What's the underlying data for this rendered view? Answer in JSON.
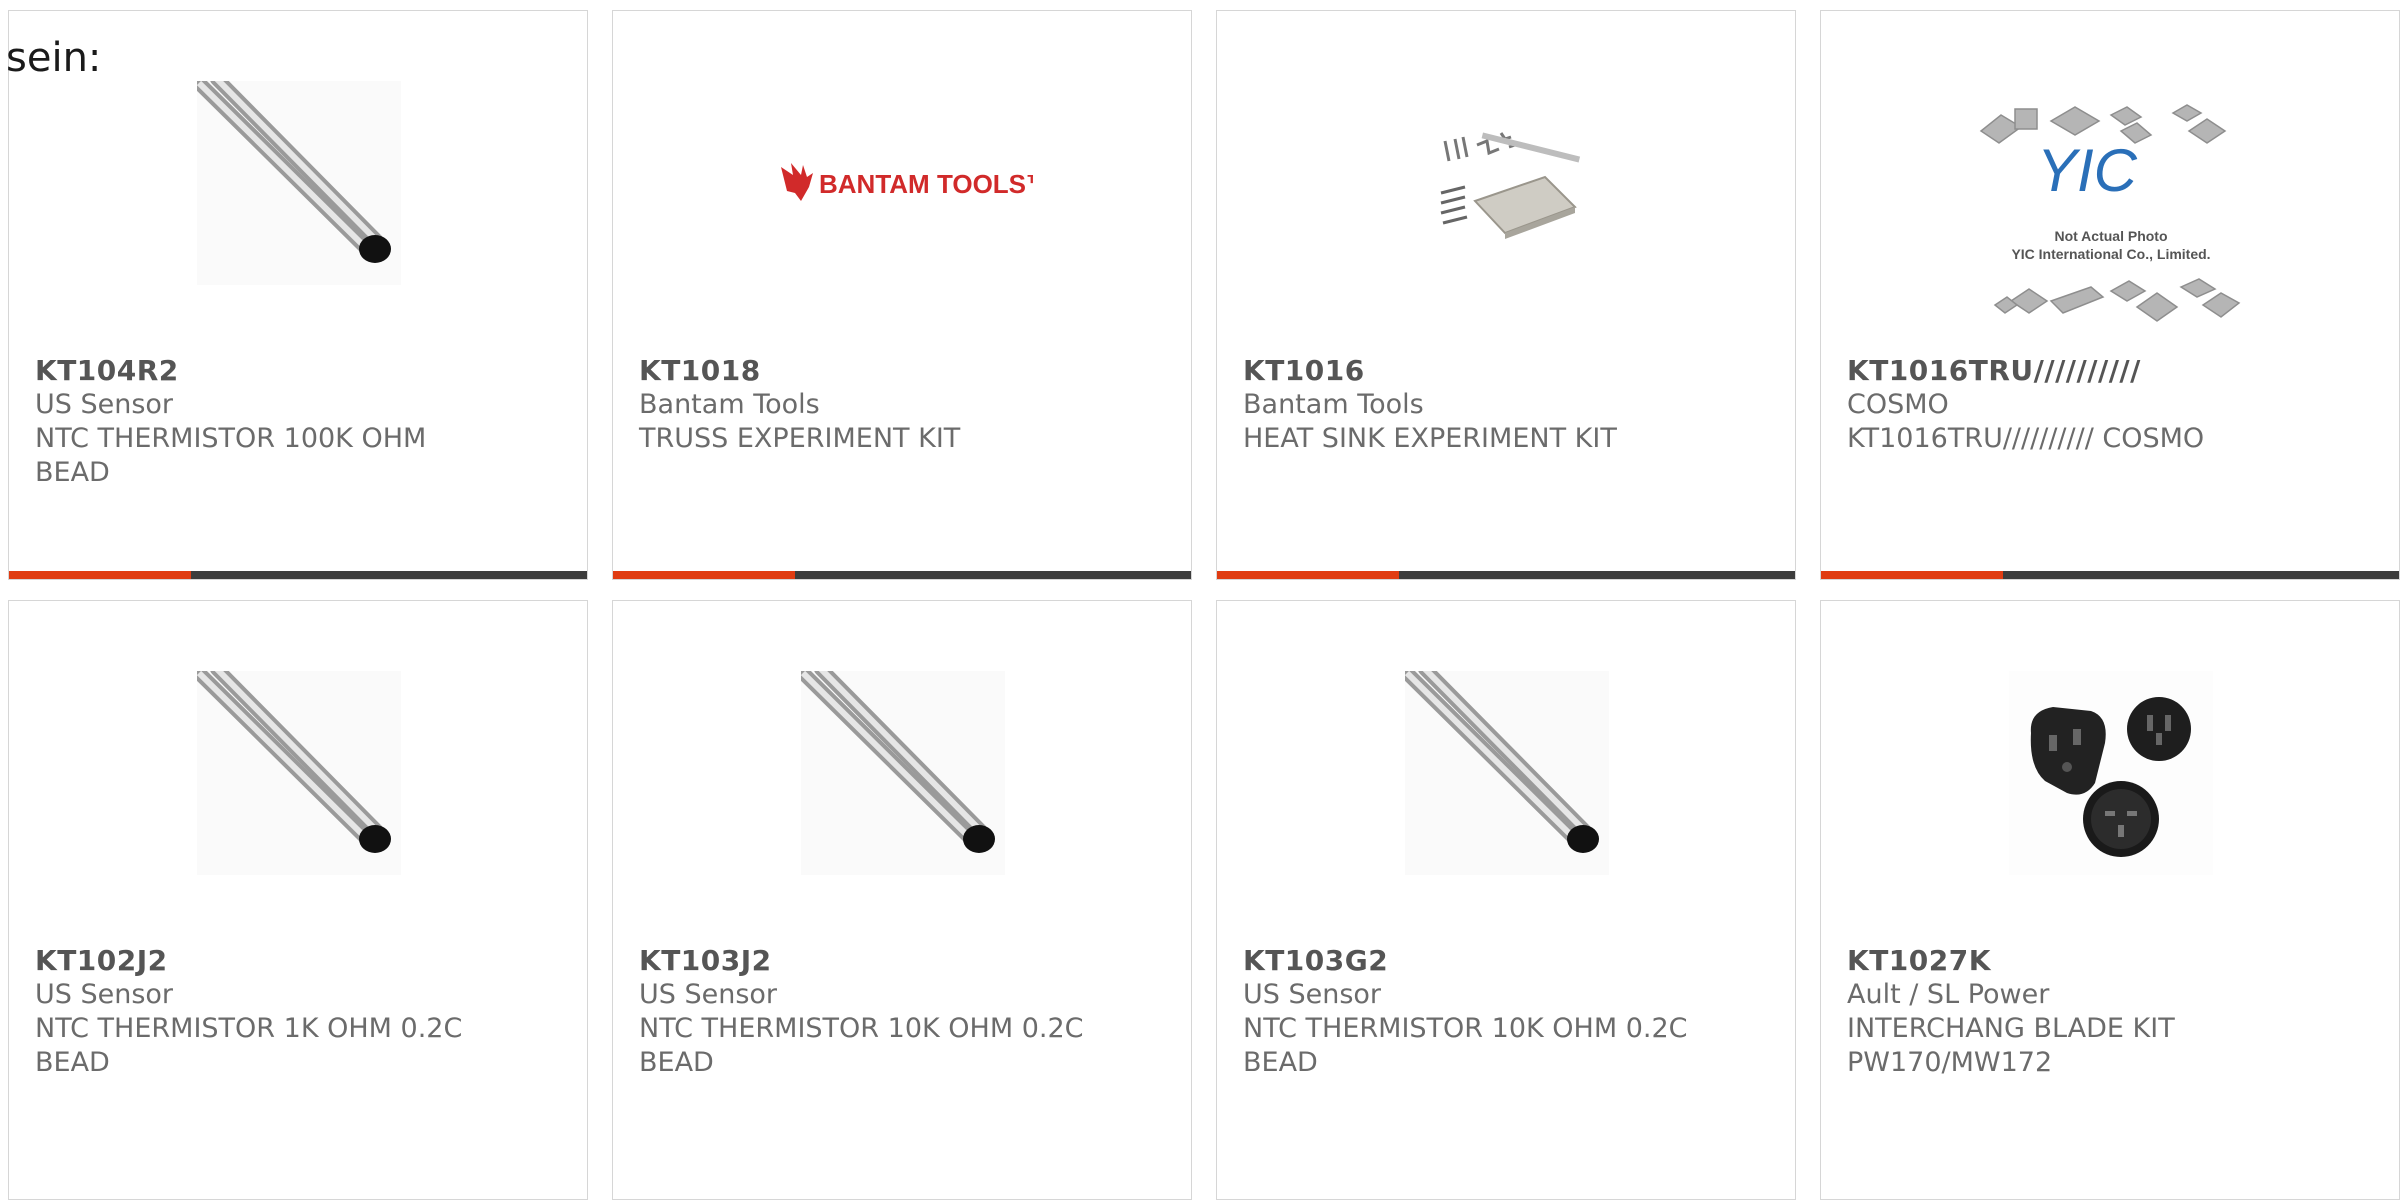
{
  "heading": "sein:",
  "products": [
    {
      "part": "KT104R2",
      "brand": "US Sensor",
      "desc_line1": "NTC THERMISTOR 100K OHM",
      "desc_line2": "BEAD",
      "image": "thermistor-bead",
      "image_label": ""
    },
    {
      "part": "KT1018",
      "brand": "Bantam Tools",
      "desc_line1": "TRUSS EXPERIMENT KIT",
      "desc_line2": "",
      "image": "bantam-tools-logo",
      "image_label": "BANTAM TOOLS™"
    },
    {
      "part": "KT1016",
      "brand": "Bantam Tools",
      "desc_line1": "HEAT SINK EXPERIMENT KIT",
      "desc_line2": "",
      "image": "heat-sink-kit",
      "image_label": ""
    },
    {
      "part": "KT1016TRU//////////",
      "brand": "COSMO",
      "desc_line1": "KT1016TRU////////// COSMO",
      "desc_line2": "",
      "image": "yic-placeholder",
      "image_label": "Not Actual Photo",
      "image_label2": "YIC International Co., Limited."
    },
    {
      "part": "KT102J2",
      "brand": "US Sensor",
      "desc_line1": "NTC THERMISTOR 1K OHM 0.2C",
      "desc_line2": "BEAD",
      "image": "thermistor-bead",
      "image_label": ""
    },
    {
      "part": "KT103J2",
      "brand": "US Sensor",
      "desc_line1": "NTC THERMISTOR 10K OHM 0.2C",
      "desc_line2": "BEAD",
      "image": "thermistor-bead",
      "image_label": ""
    },
    {
      "part": "KT103G2",
      "brand": "US Sensor",
      "desc_line1": "NTC THERMISTOR 10K OHM 0.2C",
      "desc_line2": "BEAD",
      "image": "thermistor-bead",
      "image_label": ""
    },
    {
      "part": "KT1027K",
      "brand": "Ault / SL Power",
      "desc_line1": "INTERCHANG BLADE KIT",
      "desc_line2": "PW170/MW172",
      "image": "plug-adapters",
      "image_label": ""
    }
  ],
  "colors": {
    "accent": "#e03c12",
    "bar": "#3c3c3c",
    "border": "#d6d6d6",
    "text": "#6b6b6b"
  }
}
